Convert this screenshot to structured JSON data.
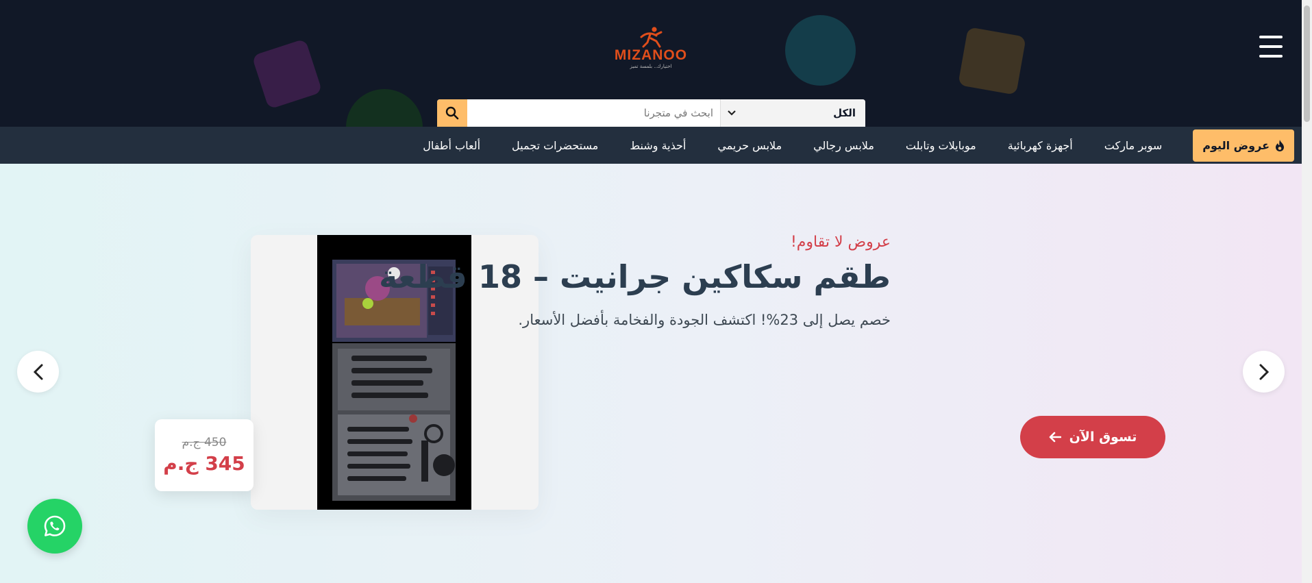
{
  "header": {
    "logo": {
      "text": "MIZANOO",
      "tagline": "اختيارك.. بلمسة تميز",
      "icon": "runner-logo-icon",
      "color": "#e04e1b"
    },
    "menu_icon": "hamburger-menu-icon",
    "search": {
      "category": "الكل",
      "placeholder": "ابحث في متجرنا",
      "value": "",
      "button_icon": "search-icon"
    }
  },
  "nav": {
    "deals": {
      "label": "عروض اليوم",
      "icon": "fire-icon",
      "color": "#febd69"
    },
    "items": [
      "سوبر ماركت",
      "أجهزة كهربائية",
      "موبايلات وتابلت",
      "ملابس رجالي",
      "ملابس حريمي",
      "أحذية وشنط",
      "مستحضرات تجميل",
      "ألعاب أطفال"
    ]
  },
  "hero": {
    "subtitle": "عروض لا تقاوم!",
    "title": "طقم سكاكين جرانيت – 18 قطعة",
    "description": "خصم يصل إلى 23%! اكتشف الجودة والفخامة بأفضل الأسعار.",
    "cta": {
      "label": "تسوق الآن",
      "icon": "arrow-left-icon"
    },
    "price": {
      "old": "450 ج.م",
      "new": "345 ج.م"
    },
    "image": "knife-set-product-image",
    "prev_icon": "chevron-left-icon",
    "next_icon": "chevron-right-icon",
    "accent_color": "#d33f49"
  },
  "whatsapp": {
    "icon": "whatsapp-icon",
    "color": "#25d366"
  }
}
